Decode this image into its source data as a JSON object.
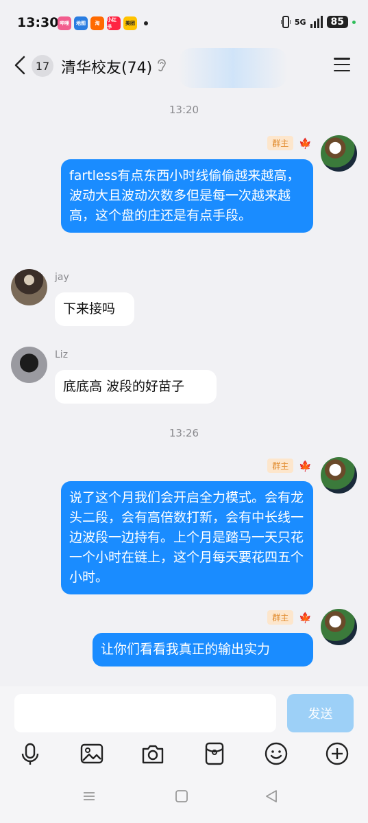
{
  "status_bar": {
    "time": "13:30",
    "app_icons": [
      {
        "name": "bilibili-icon",
        "label": "哔哩",
        "color": "#f25d8e"
      },
      {
        "name": "maps-icon",
        "label": "地图",
        "color": "#2a7de1"
      },
      {
        "name": "taobao-icon",
        "label": "淘",
        "color": "#ff6a00"
      },
      {
        "name": "xiaohongshu-icon",
        "label": "小红书",
        "color": "#ff2442"
      },
      {
        "name": "meituan-icon",
        "label": "美团",
        "color": "#ffc300"
      }
    ],
    "network": "5G",
    "battery": "85"
  },
  "header": {
    "unread_count": "17",
    "title": "清华校友(74)"
  },
  "messages": [
    {
      "type": "timestamp",
      "text": "13:20"
    },
    {
      "type": "outgoing",
      "sender_role": "群主",
      "text": "fartless有点东西小时线偷偷越来越高，波动大且波动次数多但是每一次越来越高，这个盘的庄还是有点手段。"
    },
    {
      "type": "incoming",
      "sender": "jay",
      "text": "下来接吗"
    },
    {
      "type": "incoming",
      "sender": "Liz",
      "text": "底底高 波段的好苗子"
    },
    {
      "type": "timestamp",
      "text": "13:26"
    },
    {
      "type": "outgoing",
      "sender_role": "群主",
      "text": "说了这个月我们会开启全力模式。会有龙头二段，会有高倍数打新，会有中长线一边波段一边持有。上个月是踏马一天只花一个小时在链上，这个月每天要花四五个小时。"
    },
    {
      "type": "outgoing",
      "sender_role": "群主",
      "text": "让你们看看我真正的输出实力"
    }
  ],
  "input": {
    "placeholder": "",
    "send_label": "发送"
  },
  "toolbar": [
    "mic-icon",
    "image-icon",
    "camera-icon",
    "red-packet-icon",
    "emoji-icon",
    "add-icon"
  ],
  "colors": {
    "bubble_out": "#1a8cff",
    "bubble_in": "#ffffff",
    "send_disabled": "#9dd0f7",
    "role_badge_bg": "#fde6cc",
    "role_badge_text": "#e08a2c"
  }
}
